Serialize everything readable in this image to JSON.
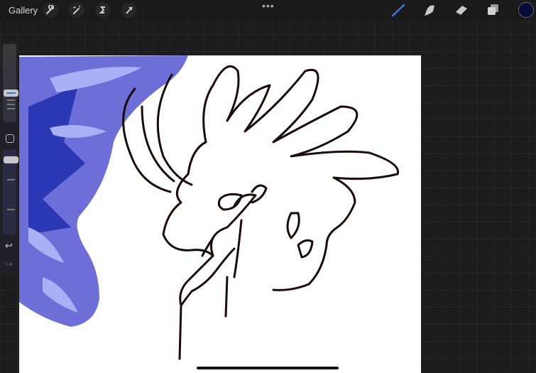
{
  "topbar": {
    "gallery_label": "Gallery",
    "left_tools": [
      "wrench-icon",
      "magic-wand-icon",
      "selection-icon",
      "transform-arrow-icon"
    ],
    "more_label": "•••",
    "right_tools": [
      "brush-icon",
      "smudge-icon",
      "eraser-icon",
      "layers-icon"
    ],
    "active_tool": "brush",
    "accent_color": "#3a78e0",
    "current_color": "#050a3a"
  },
  "sidebar": {
    "brush_size_slider": "brush-size",
    "opacity_slider": "opacity",
    "modify_button": "square",
    "undo": "undo-icon",
    "redo": "redo-icon"
  }
}
